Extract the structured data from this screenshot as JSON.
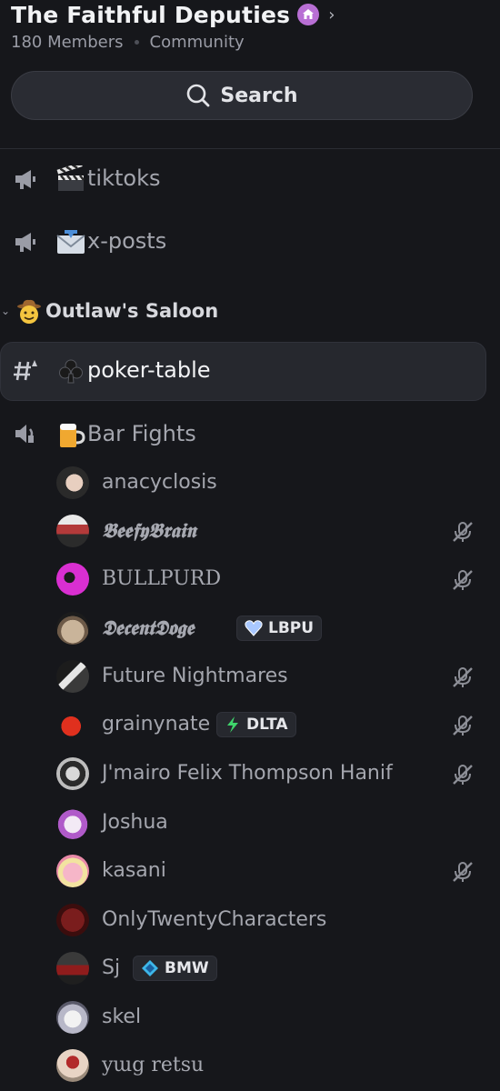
{
  "server": {
    "name": "The Faithful Deputies",
    "members": "180 Members",
    "type": "Community"
  },
  "search": {
    "label": "Search"
  },
  "channels": [
    {
      "name": "tiktoks",
      "emoji": "clapper-board",
      "kind": "announcement"
    },
    {
      "name": "x-posts",
      "emoji": "incoming-envelope",
      "kind": "announcement"
    }
  ],
  "category": {
    "name": "Outlaw's Saloon",
    "emoji": "cowboy-face"
  },
  "category_channels": [
    {
      "name": "poker-table",
      "emoji": "club-suit",
      "kind": "text-thread",
      "active": true
    },
    {
      "name": "Bar Fights",
      "emoji": "beer-mug",
      "kind": "voice"
    }
  ],
  "voice_members": [
    {
      "name": "anacyclosis",
      "muted": false
    },
    {
      "name": "𝕭𝖊𝖊𝖋𝖞𝕭𝖗𝖆𝖎𝖓",
      "muted": true
    },
    {
      "name": "BULLPURD",
      "muted": true
    },
    {
      "name": "𝕯𝖊𝖈𝖊𝖓𝖙𝕯𝖔𝖌𝖊",
      "muted": false,
      "tag": "LBPU",
      "tag_icon": "heart"
    },
    {
      "name": "Future Nightmares",
      "muted": true
    },
    {
      "name": "grainynate",
      "muted": true,
      "tag": "DLTA",
      "tag_icon": "lightning"
    },
    {
      "name": "J'mairo Felix Thompson Hanif",
      "muted": true
    },
    {
      "name": "Joshua",
      "muted": false
    },
    {
      "name": "kasani",
      "muted": true
    },
    {
      "name": "OnlyTwentyCharacters",
      "muted": false
    },
    {
      "name": "Sj",
      "muted": false,
      "tag": "BMW",
      "tag_icon": "diamond"
    },
    {
      "name": "skel",
      "muted": false
    },
    {
      "name": "yɯg retsu",
      "muted": false
    }
  ],
  "colors": {
    "background": "#16171b",
    "boost": "#b86fd4",
    "muted_icon": "#8c8e96"
  }
}
